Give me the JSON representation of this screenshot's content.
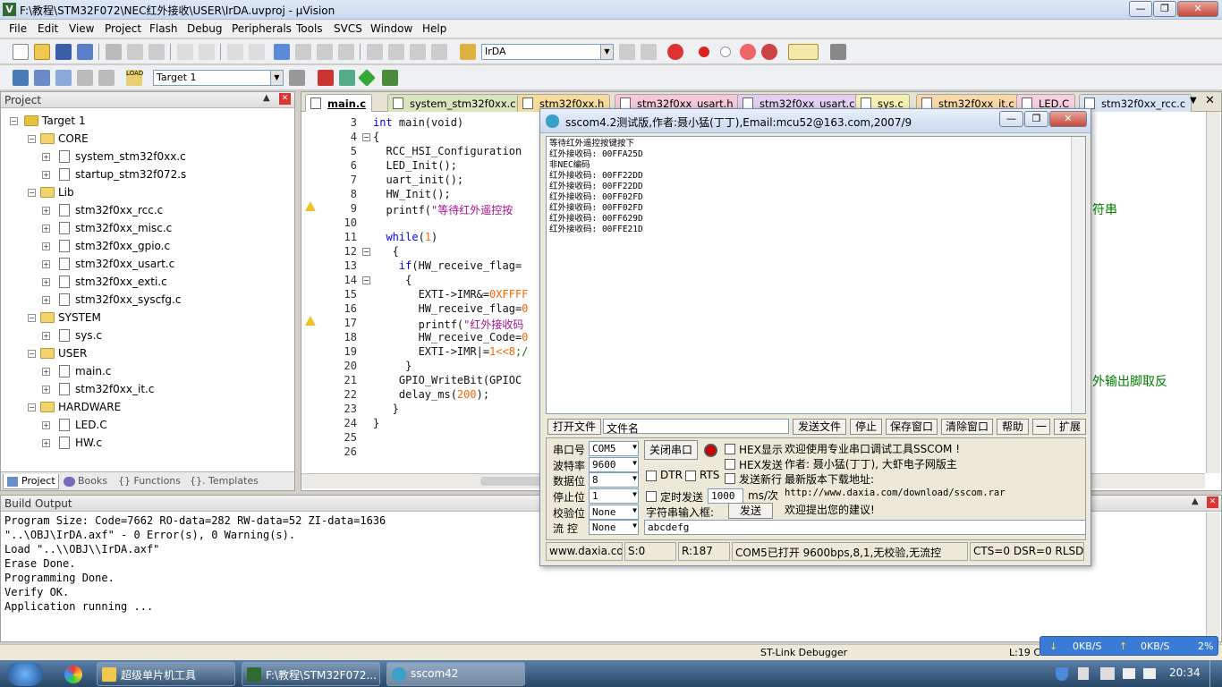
{
  "window": {
    "title": "F:\\教程\\STM32F072\\NEC红外接收\\USER\\IrDA.uvproj - µVision"
  },
  "menu": [
    "File",
    "Edit",
    "View",
    "Project",
    "Flash",
    "Debug",
    "Peripherals",
    "Tools",
    "SVCS",
    "Window",
    "Help"
  ],
  "toolbar": {
    "find_combo": "IrDA",
    "target_combo": "Target 1"
  },
  "project": {
    "title": "Project",
    "tree": {
      "target": "Target 1",
      "groups": [
        {
          "name": "CORE",
          "files": [
            "system_stm32f0xx.c",
            "startup_stm32f072.s"
          ]
        },
        {
          "name": "Lib",
          "files": [
            "stm32f0xx_rcc.c",
            "stm32f0xx_misc.c",
            "stm32f0xx_gpio.c",
            "stm32f0xx_usart.c",
            "stm32f0xx_exti.c",
            "stm32f0xx_syscfg.c"
          ]
        },
        {
          "name": "SYSTEM",
          "files": [
            "sys.c"
          ]
        },
        {
          "name": "USER",
          "files": [
            "main.c",
            "stm32f0xx_it.c"
          ]
        },
        {
          "name": "HARDWARE",
          "files": [
            "LED.C",
            "HW.c"
          ]
        }
      ]
    },
    "tabs": [
      "Project",
      "Books",
      "{} Functions",
      "{}. Templates"
    ]
  },
  "editor": {
    "tabs": [
      "main.c",
      "system_stm32f0xx.c",
      "stm32f0xx.h",
      "stm32f0xx_usart.h",
      "stm32f0xx_usart.c",
      "sys.c",
      "stm32f0xx_it.c",
      "LED.C",
      "stm32f0xx_rcc.c"
    ],
    "line_numbers": [
      "3",
      "4",
      "5",
      "6",
      "7",
      "8",
      "9",
      "10",
      "11",
      "12",
      "13",
      "14",
      "15",
      "16",
      "17",
      "18",
      "19",
      "20",
      "21",
      "22",
      "23",
      "24",
      "25",
      "26"
    ],
    "code": {
      "l3_kw": "int",
      "l3_rest": " main(void)",
      "l4": "{",
      "l5": "  RCC_HSI_Configuration",
      "l6": "  LED_Init();",
      "l7": "  uart_init();",
      "l8": "  HW_Init();",
      "l9_pre": "  printf(",
      "l9_str": "\"等待红外遥控按",
      "l11_kw": "while",
      "l11_num": "1",
      "l11_rest": "(",
      "l12": "   {",
      "l13_kw": "if",
      "l13_rest": "(HW_receive_flag=",
      "l14": "     {",
      "l15_pre": "       EXTI->IMR&=",
      "l15_num": "0XFFFF",
      "l16_pre": "       HW_receive_flag=",
      "l16_num": "0",
      "l17_pre": "       printf(",
      "l17_str": "\"红外接收码",
      "l18_pre": "       HW_receive_Code=",
      "l18_num": "0",
      "l19_pre": "       EXTI->IMR|=",
      "l19_num": "1<<8",
      "l19_rest": ";/",
      "l20": "     }",
      "l21": "    GPIO_WriteBit(GPIOC",
      "l22_pre": "    delay_ms(",
      "l22_num": "200",
      "l22_rest": ");",
      "l23": "   }",
      "l24": "}",
      "cmt9": "符串",
      "cmt21": "外输出脚取反"
    }
  },
  "build": {
    "title": "Build Output",
    "lines": "Program Size: Code=7662 RO-data=282 RW-data=52 ZI-data=1636\n\"..\\OBJ\\IrDA.axf\" - 0 Error(s), 0 Warning(s).\nLoad \"..\\\\OBJ\\\\IrDA.axf\"\nErase Done.\nProgramming Done.\nVerify OK.\nApplication running ..."
  },
  "status": {
    "debugger": "ST-Link Debugger",
    "pos": "L:19 C:5"
  },
  "sscom": {
    "title": "sscom4.2测试版,作者:聂小猛(丁丁),Email:mcu52@163.com,2007/9",
    "recv": "等待红外遥控按键按下\n红外接收码: 00FFA25D\n非NEC编码\n红外接收码: 00FF22DD\n红外接收码: 00FF22DD\n红外接收码: 00FF02FD\n红外接收码: 00FF02FD\n红外接收码: 00FF629D\n红外接收码: 00FFE21D",
    "open_file": "打开文件",
    "file_name": "文件名",
    "send_file": "发送文件",
    "stop": "停止",
    "save_window": "保存窗口",
    "clear_window": "清除窗口",
    "help": "帮助",
    "minus": "一",
    "expand": "扩展",
    "port_label": "串口号",
    "port": "COM5",
    "baud_label": "波特率",
    "baud": "9600",
    "data_label": "数据位",
    "data": "8",
    "stop_label": "停止位",
    "stopbits": "1",
    "parity_label": "校验位",
    "parity": "None",
    "flow_label": "流 控",
    "flow": "None",
    "close_port": "关闭串口",
    "hex_show": "HEX显示",
    "hex_send": "HEX发送",
    "dtr": "DTR",
    "rts": "RTS",
    "send_newline": "发送新行",
    "timed_send": "定时发送",
    "interval": "1000",
    "interval_unit": "ms/次",
    "string_input": "字符串输入框:",
    "send": "发送",
    "input_value": "abcdefg",
    "info": [
      "欢迎使用专业串口调试工具SSCOM !",
      "作者: 聂小猛(丁丁), 大虾电子网版主",
      "最新版本下载地址:",
      "http://www.daxia.com/download/sscom.rar",
      "欢迎提出您的建议!"
    ],
    "status": {
      "site": "www.daxia.cor",
      "sent": "S:0",
      "recv": "R:187",
      "port": "COM5已打开  9600bps,8,1,无校验,无流控",
      "lines": "CTS=0 DSR=0 RLSD"
    }
  },
  "taskbar": {
    "items": [
      "超级单片机工具",
      "F:\\教程\\STM32F072...",
      "sscom42"
    ],
    "clock": "20:34"
  },
  "netspeed": {
    "down": "0KB/S",
    "up": "0KB/S",
    "cpu": "2%"
  }
}
